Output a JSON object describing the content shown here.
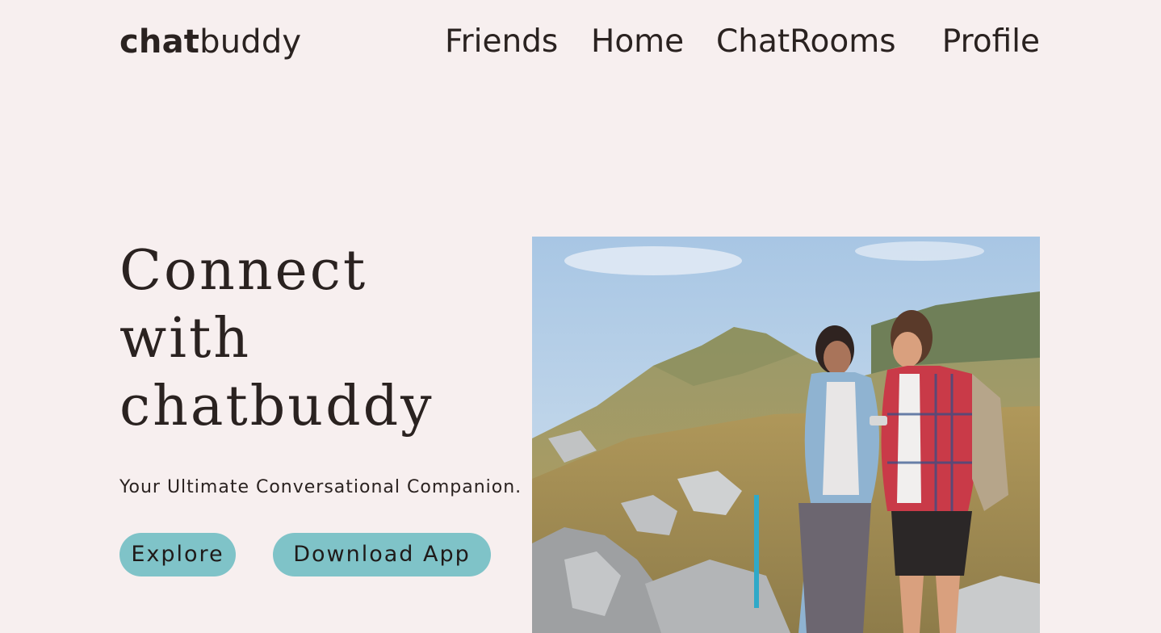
{
  "header": {
    "logo_bold": "chat",
    "logo_light": "buddy",
    "nav": [
      "Friends",
      "Home",
      "ChatRooms",
      "Profile"
    ]
  },
  "hero": {
    "title_lines": [
      "Connect",
      "with",
      "chatbuddy"
    ],
    "tagline": "Your Ultimate Conversational Companion.",
    "buttons": {
      "explore": "Explore",
      "download": "Download App"
    }
  },
  "image": {
    "subject": "hikers-photo"
  },
  "colors": {
    "background": "#f7efef",
    "text": "#2a2220",
    "button": "#7fc3c8"
  }
}
